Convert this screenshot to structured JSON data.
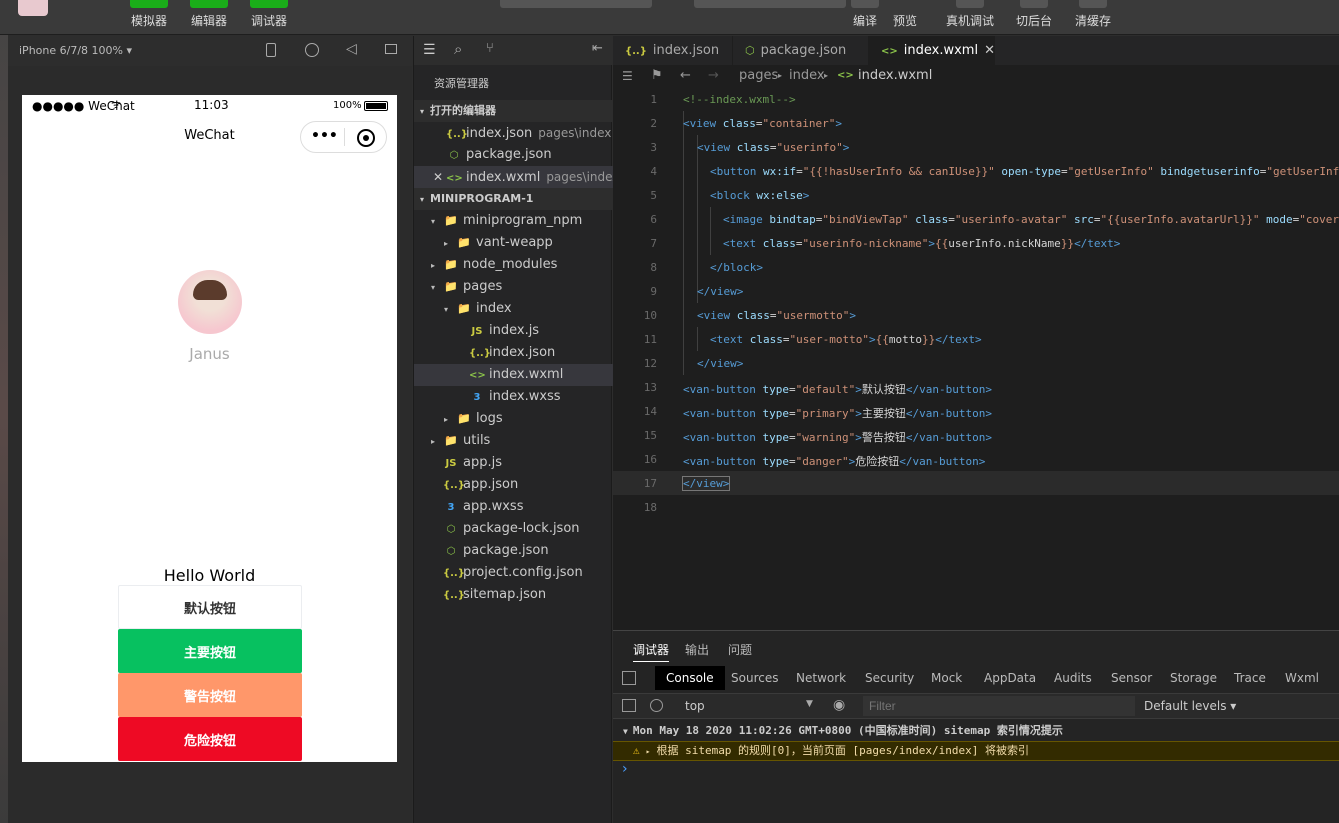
{
  "toolbar": {
    "buttons": [
      {
        "label": "模拟器"
      },
      {
        "label": "编辑器"
      },
      {
        "label": "调试器"
      }
    ],
    "right_buttons": [
      {
        "label": "编译"
      },
      {
        "label": "预览"
      },
      {
        "label": "真机调试"
      },
      {
        "label": "切后台"
      },
      {
        "label": "清缓存"
      }
    ],
    "accent": "#1aad19"
  },
  "simulator": {
    "device": "iPhone 6/7/8 100% ▾",
    "status": {
      "carrier": "●●●●● WeChat",
      "time": "11:03",
      "battery": "100%"
    },
    "nav_title": "WeChat",
    "user_name": "Janus",
    "motto": "Hello World",
    "buttons": [
      {
        "label": "默认按钮",
        "color": "#ffffff",
        "text_color": "#333333"
      },
      {
        "label": "主要按钮",
        "color": "#07c160",
        "text_color": "#ffffff"
      },
      {
        "label": "警告按钮",
        "color": "#ff976a",
        "text_color": "#ffffff"
      },
      {
        "label": "危险按钮",
        "color": "#ee0a24",
        "text_color": "#ffffff"
      }
    ]
  },
  "explorer": {
    "title": "资源管理器",
    "open_editors_header": "打开的编辑器",
    "open_editors": [
      {
        "name": "index.json",
        "path": "pages\\index",
        "icon": "{..}"
      },
      {
        "name": "package.json",
        "path": "",
        "icon": "⬡"
      },
      {
        "name": "index.wxml",
        "path": "pages\\index",
        "icon": "<>"
      }
    ],
    "project_header": "MINIPROGRAM-1",
    "tree": [
      {
        "name": "miniprogram_npm",
        "icon": "📁",
        "depth": 1,
        "arrow": "▾"
      },
      {
        "name": "vant-weapp",
        "icon": "📁",
        "depth": 2,
        "arrow": "▸"
      },
      {
        "name": "node_modules",
        "icon": "📁",
        "depth": 1,
        "arrow": "▸"
      },
      {
        "name": "pages",
        "icon": "📁",
        "depth": 1,
        "arrow": "▾"
      },
      {
        "name": "index",
        "icon": "📁",
        "depth": 2,
        "arrow": "▾"
      },
      {
        "name": "index.js",
        "icon": "JS",
        "depth": 3,
        "arrow": ""
      },
      {
        "name": "index.json",
        "icon": "{..}",
        "depth": 3,
        "arrow": ""
      },
      {
        "name": "index.wxml",
        "icon": "<>",
        "depth": 3,
        "arrow": ""
      },
      {
        "name": "index.wxss",
        "icon": "3",
        "depth": 3,
        "arrow": ""
      },
      {
        "name": "logs",
        "icon": "📁",
        "depth": 2,
        "arrow": "▸"
      },
      {
        "name": "utils",
        "icon": "📁",
        "depth": 1,
        "arrow": "▸"
      },
      {
        "name": "app.js",
        "icon": "JS",
        "depth": 1,
        "arrow": ""
      },
      {
        "name": "app.json",
        "icon": "{..}",
        "depth": 1,
        "arrow": ""
      },
      {
        "name": "app.wxss",
        "icon": "3",
        "depth": 1,
        "arrow": ""
      },
      {
        "name": "package-lock.json",
        "icon": "⬡",
        "depth": 1,
        "arrow": ""
      },
      {
        "name": "package.json",
        "icon": "⬡",
        "depth": 1,
        "arrow": ""
      },
      {
        "name": "project.config.json",
        "icon": "{..}",
        "depth": 1,
        "arrow": ""
      },
      {
        "name": "sitemap.json",
        "icon": "{..}",
        "depth": 1,
        "arrow": ""
      }
    ]
  },
  "editor": {
    "tabs": [
      {
        "label": "index.json",
        "icon": "{..}"
      },
      {
        "label": "package.json",
        "icon": "⬡"
      },
      {
        "label": "index.wxml",
        "icon": "<>"
      }
    ],
    "breadcrumb": [
      "pages",
      "index",
      "index.wxml"
    ],
    "line_numbers": [
      "1",
      "2",
      "3",
      "4",
      "5",
      "6",
      "7",
      "8",
      "9",
      "10",
      "11",
      "12",
      "13",
      "14",
      "15",
      "16",
      "17",
      "18"
    ]
  },
  "panel": {
    "tabs": [
      "调试器",
      "输出",
      "问题"
    ],
    "devtools_tabs": [
      "Console",
      "Sources",
      "Network",
      "Security",
      "Mock",
      "AppData",
      "Audits",
      "Sensor",
      "Storage",
      "Trace",
      "Wxml"
    ],
    "context": "top",
    "filter_placeholder": "Filter",
    "levels": "Default levels ▾",
    "log_header": "Mon May 18 2020 11:02:26 GMT+0800 (中国标准时间) sitemap 索引情况提示",
    "log_warning": "根据 sitemap 的规则[0]，当前页面 [pages/index/index] 将被索引",
    "prompt": "›"
  }
}
